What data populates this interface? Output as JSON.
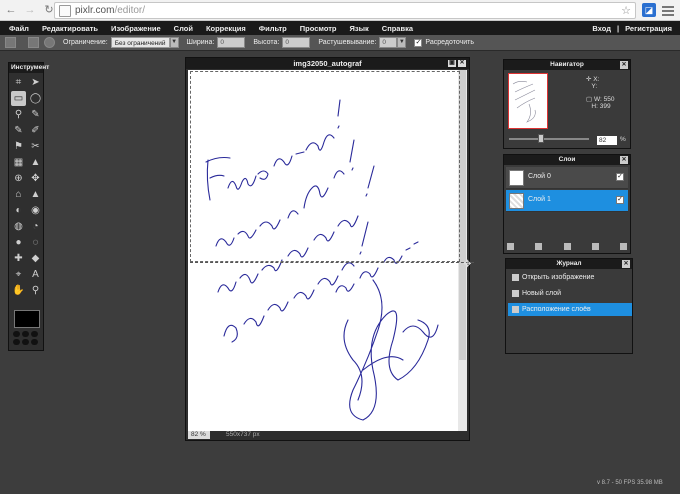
{
  "browser": {
    "url_host": "pixlr.com",
    "url_path": "/editor/",
    "icons": [
      "back-arrow-icon",
      "forward-arrow-icon",
      "reload-icon",
      "star-icon",
      "extension-icon",
      "menu-icon"
    ]
  },
  "menu": {
    "items": [
      "Файл",
      "Редактировать",
      "Изображение",
      "Слой",
      "Коррекция",
      "Фильтр",
      "Просмотр",
      "Язык",
      "Справка"
    ],
    "login": "Вход",
    "sep": "|",
    "register": "Регистрация"
  },
  "options": {
    "constraint_label": "Ограничение:",
    "constraint_value": "Без ограничений",
    "width_label": "Ширина:",
    "width_value": "0",
    "height_label": "Высота:",
    "height_value": "0",
    "feather_label": "Растушевывание:",
    "feather_value": "0",
    "antialias_label": "Расредоточить",
    "antialias_checked": true
  },
  "tools": {
    "title": "Инструмент",
    "glyphs": [
      "⌗",
      "➤",
      "▭",
      "◯",
      "⚲",
      "✎",
      "✎",
      "✐",
      "⚑",
      "✂",
      "▦",
      "▲",
      "⊕",
      "✥",
      "⌂",
      "▲",
      "◐",
      "◉",
      "◍",
      "◔",
      "●",
      "◌",
      "✚",
      "◆",
      "⌖",
      "A",
      "✋",
      "⚲"
    ]
  },
  "document": {
    "title": "img32050_autograf",
    "zoom": "82",
    "zoom_unit": "%",
    "dimensions": "550x737 px"
  },
  "navigator": {
    "title": "Навигатор",
    "x_label": "X:",
    "y_label": "Y:",
    "w_label": "W:",
    "w_value": "550",
    "h_label": "H:",
    "h_value": "399",
    "zoom": "82",
    "zoom_unit": "%",
    "zoom_fraction": 0.42
  },
  "layers": {
    "title": "Слои",
    "items": [
      {
        "name": "Слой 0",
        "selected": false
      },
      {
        "name": "Слой 1",
        "selected": true
      }
    ]
  },
  "history": {
    "title": "Журнал",
    "items": [
      {
        "name": "Открыть изображение",
        "selected": false
      },
      {
        "name": "Новый слой",
        "selected": false
      },
      {
        "name": "Расположение слоёв",
        "selected": true
      }
    ]
  },
  "version": "v 8.7 - 50 FPS 35.98 MB",
  "colors": {
    "accent": "#1e8fe0",
    "bg": "#3d3d3d",
    "ink": "#2a2a9a"
  }
}
